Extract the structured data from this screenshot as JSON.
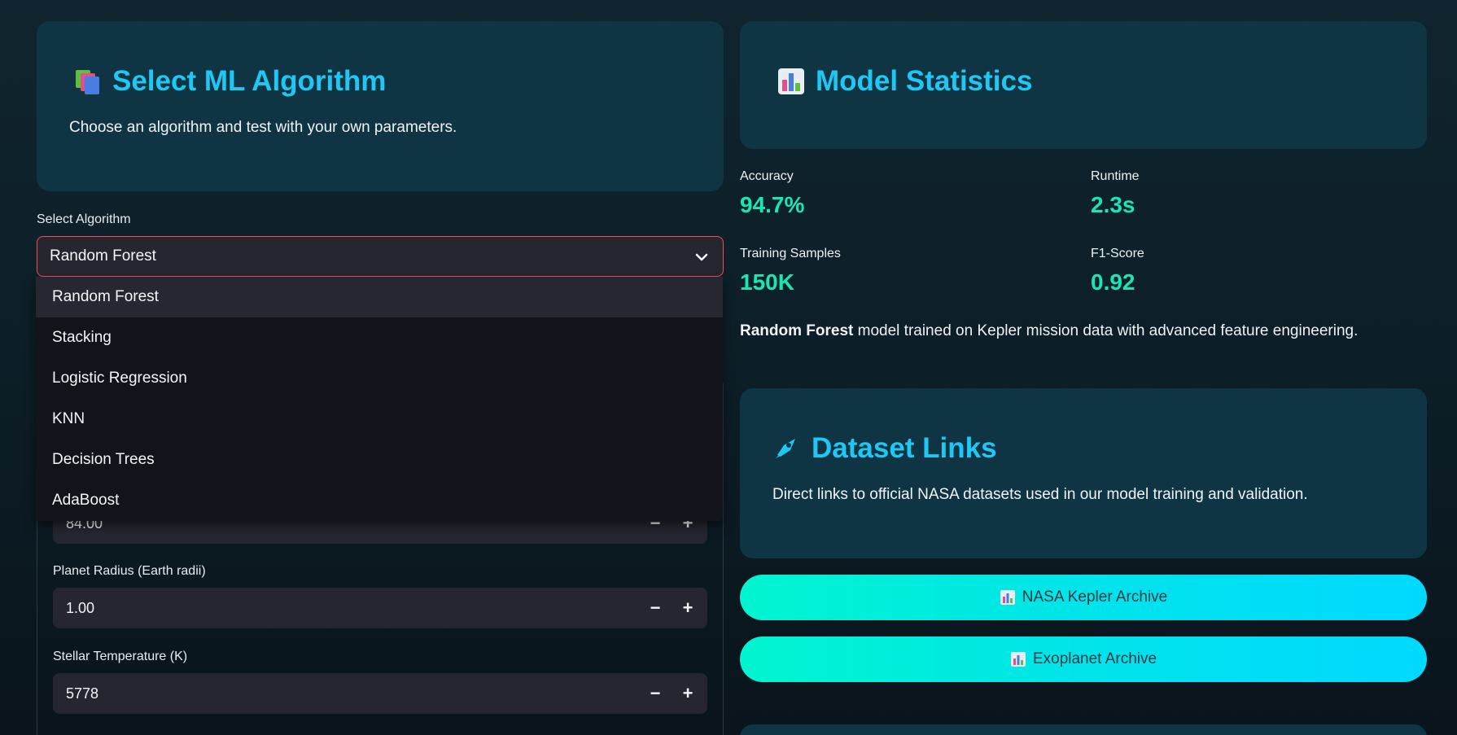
{
  "algorithm_card": {
    "title": "Select ML Algorithm",
    "subtitle": "Choose an algorithm and test with your own parameters.",
    "icon": "books-icon"
  },
  "algorithm_select": {
    "label": "Select Algorithm",
    "selected": "Random Forest",
    "options": [
      "Random Forest",
      "Stacking",
      "Logistic Regression",
      "KNN",
      "Decision Trees",
      "AdaBoost"
    ]
  },
  "inputs": {
    "partial_value": "84.00",
    "planet_radius": {
      "label": "Planet Radius (Earth radii)",
      "value": "1.00"
    },
    "stellar_temp": {
      "label": "Stellar Temperature (K)",
      "value": "5778"
    },
    "minus_symbol": "−",
    "plus_symbol": "+"
  },
  "stats_card": {
    "title": "Model Statistics",
    "icon": "bar-chart-icon"
  },
  "metrics": [
    {
      "label": "Accuracy",
      "value": "94.7%"
    },
    {
      "label": "Runtime",
      "value": "2.3s"
    },
    {
      "label": "Training Samples",
      "value": "150K"
    },
    {
      "label": "F1-Score",
      "value": "0.92"
    }
  ],
  "model_description": {
    "model_name": "Random Forest",
    "text": " model trained on Kepler mission data with advanced feature engineering."
  },
  "links_card": {
    "title": "Dataset Links",
    "subtitle": "Direct links to official NASA datasets used in our model training and validation.",
    "icon": "rocket-icon"
  },
  "link_buttons": [
    {
      "label": "NASA Kepler Archive"
    },
    {
      "label": "Exoplanet Archive"
    }
  ],
  "colors": {
    "accent_title": "#1fc8f2",
    "metric_value": "#19e6b6",
    "select_border": "#ff4b4b",
    "card_bg": "#0f3545"
  }
}
